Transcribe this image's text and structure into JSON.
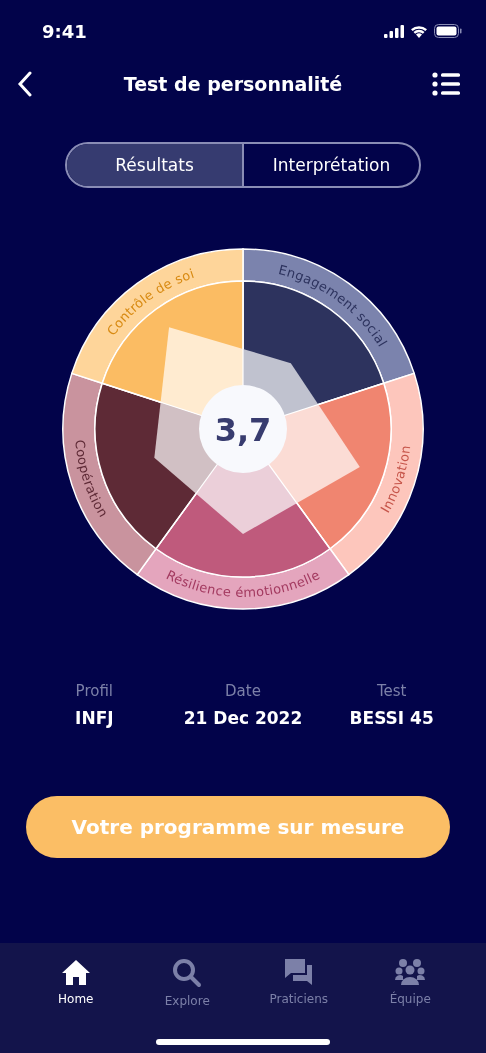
{
  "status_bar": {
    "time": "9:41"
  },
  "header": {
    "title": "Test de personnalité"
  },
  "segmented": [
    {
      "label": "Résultats",
      "selected": true
    },
    {
      "label": "Interprétation",
      "selected": false
    }
  ],
  "chart": {
    "score": "3,7",
    "segments": [
      {
        "label": "Engagement social",
        "color": "#7b83ad"
      },
      {
        "label": "Innovation",
        "color": "#fdc6bc"
      },
      {
        "label": "Résilience émotionnelle",
        "color": "#e4a5bd"
      },
      {
        "label": "Coopération",
        "color": "#c9939e"
      },
      {
        "label": "Contrôle de soi",
        "color": "#fed59a"
      }
    ]
  },
  "info": [
    {
      "label": "Profil",
      "value": "INFJ"
    },
    {
      "label": "Date",
      "value": "21 Dec 2022"
    },
    {
      "label": "Test",
      "value": "BESSI 45"
    }
  ],
  "cta": {
    "label": "Votre programme sur mesure"
  },
  "tab_bar": [
    {
      "kind": "home",
      "label": "Home",
      "selected": true
    },
    {
      "kind": "search",
      "label": "Explore",
      "selected": false
    },
    {
      "kind": "chat",
      "label": "Praticiens",
      "selected": false
    },
    {
      "kind": "team",
      "label": "Équipe",
      "selected": false
    }
  ]
}
